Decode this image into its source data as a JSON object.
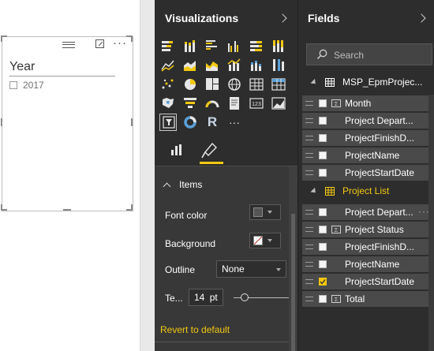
{
  "canvas": {
    "slicer": {
      "title": "Year",
      "items": [
        "2017"
      ]
    }
  },
  "visualizations": {
    "title": "Visualizations",
    "icons": [
      "stacked-bar-chart",
      "stacked-column-chart",
      "clustered-bar-chart",
      "clustered-column-chart",
      "100-stacked-bar-chart",
      "100-stacked-column-chart",
      "line-chart",
      "area-chart",
      "stacked-area-chart",
      "line-and-column-chart",
      "line-and-stacked-column-chart",
      "ribbon-chart",
      "scatter-chart",
      "pie-chart",
      "treemap",
      "map",
      "table",
      "matrix",
      "filled-map",
      "funnel",
      "gauge",
      "multi-row-card",
      "card",
      "kpi",
      "slicer",
      "donut-chart",
      "r-visual",
      "more-visuals"
    ],
    "selected_icon": "slicer",
    "r_label": "R",
    "more_label": "···",
    "format": {
      "section": "Items",
      "font_color_label": "Font color",
      "background_label": "Background",
      "outline_label": "Outline",
      "outline_value": "None",
      "text_size_label": "Te...",
      "text_size_value": "14",
      "text_size_unit": "pt",
      "text_size_slider": 0.2,
      "revert_label": "Revert to default"
    }
  },
  "fields": {
    "title": "Fields",
    "search_placeholder": "Search",
    "tables": [
      {
        "name": "MSP_EpmProjec...",
        "color": "#ffffff",
        "fields": [
          {
            "name": "Month",
            "checked": false,
            "icon": "hierarchy-icon"
          },
          {
            "name": "Project Depart...",
            "checked": false,
            "icon": ""
          },
          {
            "name": "ProjectFinishD...",
            "checked": false,
            "icon": ""
          },
          {
            "name": "ProjectName",
            "checked": false,
            "icon": ""
          },
          {
            "name": "ProjectStartDate",
            "checked": false,
            "icon": ""
          }
        ]
      },
      {
        "name": "Project List",
        "color": "#f2c811",
        "fields": [
          {
            "name": "Project Depart...",
            "checked": false,
            "icon": ""
          },
          {
            "name": "Project Status",
            "checked": false,
            "icon": "sigma-icon"
          },
          {
            "name": "ProjectFinishD...",
            "checked": false,
            "icon": ""
          },
          {
            "name": "ProjectName",
            "checked": false,
            "icon": ""
          },
          {
            "name": "ProjectStartDate",
            "checked": true,
            "icon": ""
          },
          {
            "name": "Total",
            "checked": false,
            "icon": "sigma-icon"
          }
        ]
      }
    ]
  },
  "colors": {
    "accent": "#f2c811",
    "pane_bg": "#2d2d2d",
    "field_row_bg": "#4a4a4a"
  }
}
